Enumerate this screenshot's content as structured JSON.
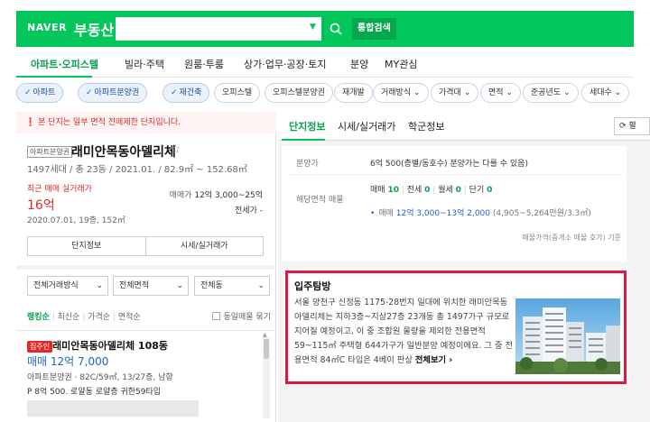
{
  "header": {
    "brand": "NAVER",
    "title": "부동산",
    "search_placeholder": "",
    "total_search_label": "통합검색",
    "accent": "#03c75a"
  },
  "nav": {
    "items": [
      "아파트·오피스텔",
      "빌라·주택",
      "원룸·투룸",
      "상가·업무·공장·토지",
      "분양",
      "MY관심"
    ]
  },
  "filters": {
    "chips": [
      {
        "label": "아파트",
        "selected": true
      },
      {
        "label": "아파트분양권",
        "selected": true
      },
      {
        "label": "재건축",
        "selected": true
      },
      {
        "label": "오피스텔",
        "selected": false
      },
      {
        "label": "오피스텔분양권",
        "selected": false
      },
      {
        "label": "재개발",
        "selected": false
      },
      {
        "label": "거래방식",
        "selected": false
      },
      {
        "label": "가격대",
        "selected": false
      },
      {
        "label": "면적",
        "selected": false
      },
      {
        "label": "준공년도",
        "selected": false
      },
      {
        "label": "세대수",
        "selected": false
      }
    ]
  },
  "left": {
    "notice": "본 단지는 일부 면적 전매제한 단지입니다.",
    "apt_badge": "아파트분양권",
    "apt_name": "래미안목동아델리체",
    "apt_info": "1497세대 / 총 23동 / 2021.01. / 82.9㎡ ~ 152.68㎡",
    "recent_label": "최근 매매 실거래가",
    "recent_price": "16억",
    "recent_date": "2020.07.01, 19층, 152㎡",
    "sale_label": "매매가",
    "sale_range": "12억 3,000~25억",
    "jeonse_label": "전세가",
    "jeonse_range": "-",
    "btn_complex_info": "단지정보",
    "btn_market_price": "시세/실거래가",
    "dropdown_trade": "전체거래방식",
    "dropdown_area": "전체면적",
    "dropdown_building": "전체동",
    "sort_options": [
      "랭킹순",
      "최신순",
      "가격순",
      "면적순"
    ],
    "same_listing_label": "동일매물 묶기",
    "listing": {
      "badge": "집주인",
      "name": "래미안목동아델리체 108동",
      "price": "매매 12억 7,000",
      "info1": "아파트분양권 · 82C/59㎡, 13/27층, 남향",
      "info2": "P 8억 500. 로얄동 로얄층 귀한59타입"
    }
  },
  "right": {
    "tabs": [
      "단지정보",
      "시세/실거래가",
      "학군정보"
    ],
    "refresh_label": "펼",
    "presale_label": "분양가",
    "presale_value": "6억 500(층별/동호수) 분양가는 다를 수 있음)",
    "matched_label": "해당면적 매물",
    "counts": {
      "sale_label": "매매",
      "sale": "10",
      "jeonse_label": "전세",
      "jeonse": "0",
      "monthly_label": "월세",
      "monthly": "0",
      "short_label": "단기",
      "short": "0"
    },
    "price_line_label": "매매",
    "price_line_value": "12억 3,000~13억 2,000",
    "price_line_unit": "(4,905~5,264만원/3.3㎡)",
    "ref_note": "매물가격(중개소 매물 호가) 기준",
    "intro": {
      "title": "입주탐방",
      "text": "서울 양천구 신정동 1175-28번지 일대에 위치한 래미안목동아델리체는 지하3층~지상27층 23개동 총 1497가구 규모로 지어질 예정이고, 이 중 조합원 물량을 제외한 전용면적 59~115㎡ 주택형 644가구가 일반분양 예정이에요. 그 중 전용면적 84㎡C 타입은 4베이 판상",
      "more": "전체보기",
      "highlight_color": "#d81b45"
    }
  }
}
